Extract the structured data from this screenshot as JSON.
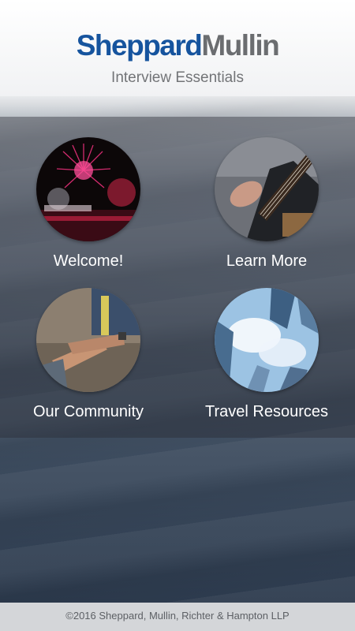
{
  "header": {
    "logo_part1": "Sheppard",
    "logo_part2": "Mullin",
    "subtitle": "Interview Essentials"
  },
  "tiles": [
    {
      "label": "Welcome!",
      "icon": "fireworks-image"
    },
    {
      "label": "Learn More",
      "icon": "guitar-image"
    },
    {
      "label": "Our Community",
      "icon": "handshake-image"
    },
    {
      "label": "Travel Resources",
      "icon": "skyscrapers-image"
    }
  ],
  "footer": {
    "copyright": "©2016 Sheppard, Mullin, Richter & Hampton LLP"
  },
  "colors": {
    "brand_blue": "#16549e",
    "brand_gray": "#6b6d70"
  }
}
